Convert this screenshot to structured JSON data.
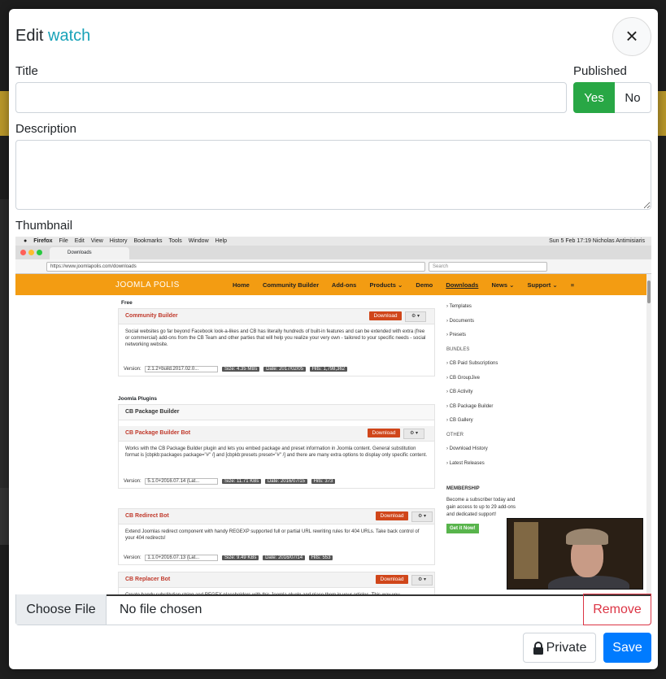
{
  "modal": {
    "title_prefix": "Edit",
    "title_name": "watch",
    "close_label": "×"
  },
  "form": {
    "title_label": "Title",
    "title_value": "",
    "published_label": "Published",
    "published_yes": "Yes",
    "published_no": "No",
    "published_selected": "Yes",
    "description_label": "Description",
    "description_value": "",
    "thumbnail_label": "Thumbnail",
    "choose_file_label": "Choose File",
    "file_status": "No file chosen",
    "remove_label": "Remove"
  },
  "actions": {
    "private_label": "Private",
    "save_label": "Save"
  },
  "colors": {
    "accent": "#17a2b8",
    "published_yes": "#28a745",
    "save": "#007bff",
    "remove": "#dc3545"
  },
  "thumbnail": {
    "menubar": {
      "app": "Firefox",
      "menus": [
        "File",
        "Edit",
        "View",
        "History",
        "Bookmarks",
        "Tools",
        "Window",
        "Help"
      ],
      "status": "Sun 5 Feb 17:19   Nicholas Antimisiaris"
    },
    "tab_title": "Downloads",
    "url": "https://www.joomlapolis.com/downloads",
    "search_placeholder": "Search",
    "site": {
      "logo": "JOOMLA POLIS",
      "nav": [
        "Home",
        "Community Builder",
        "Add-ons",
        "Products ⌄",
        "Demo",
        "Downloads",
        "News ⌄",
        "Support ⌄"
      ]
    },
    "cards": [
      {
        "name": "Community Builder",
        "download": "Download",
        "desc": "Social websites go far beyond Facebook look-a-likes and CB has literally hundreds of built-in features and can be extended with extra (free or commercial) add-ons from the CB Team and other parties that will help you realize your very own - tailored to your specific needs - social networking website.",
        "version": "2.1.2+build.2017.02.0...",
        "size": "Size: 4.35 MBs",
        "date": "Date: 2017/02/05",
        "hits": "Hits: 1,798,362"
      },
      {
        "name": "CB Package Builder Bot",
        "download": "Download",
        "desc": "Works with the CB Package Builder plugin and lets you embed package and preset information in Joomla content. General substitution format is [cbpkb:packages package=\"#\" /] and [cbpkb:presets preset=\"#\" /] and there are many extra options to display only specific content.",
        "version": "5.1.0+2016.07.14 (Lat...",
        "size": "Size: 11.71 KBs",
        "date": "Date: 2016/07/15",
        "hits": "Hits: 373"
      },
      {
        "name": "CB Redirect Bot",
        "download": "Download",
        "desc": "Extend Joomlas redirect component with handy REGEXP supported full or partial URL rewriting rules for 404 URLs. Take back control of your 404 redirects!",
        "version": "1.1.0+2016.07.13 (Lat...",
        "size": "Size: 9.49 KBs",
        "date": "Date: 2016/07/14",
        "hits": "Hits: 553"
      },
      {
        "name": "CB Replacer Bot",
        "download": "Download",
        "desc": "Create handy substitution string and REGEX placeholders with this Joomla plugin and place them in your articles. This way you"
      }
    ],
    "section_free": "Free",
    "section_plugins": "Joomla Plugins",
    "section_pkg": "CB Package Builder",
    "sidebar": [
      "Templates",
      "Documents",
      "Presets"
    ],
    "sidebar_bundles_label": "BUNDLES",
    "sidebar_bundles": [
      "CB Paid Subscriptions",
      "CB GroupJive",
      "CB Activity",
      "CB Package Builder",
      "CB Gallery"
    ],
    "sidebar_other_label": "OTHER",
    "sidebar_other": [
      "Download History",
      "Latest Releases"
    ],
    "membership_label": "MEMBERSHIP",
    "membership_text": "Become a subscriber today and gain access to up to 29 add-ons and dedicated support!",
    "get_it": "Get it Now!"
  }
}
